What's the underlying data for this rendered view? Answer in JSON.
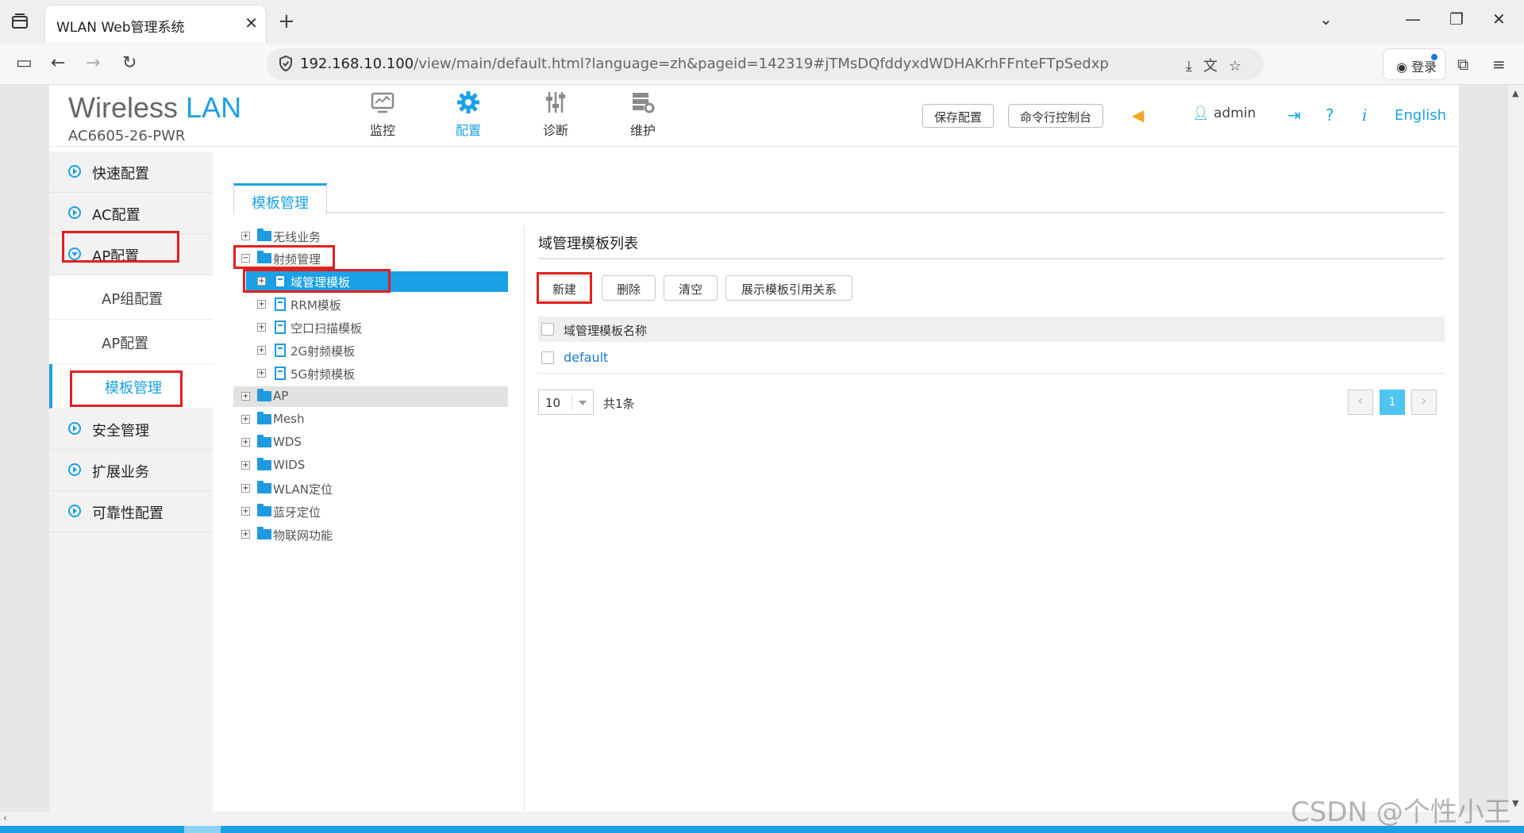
{
  "browser": {
    "tab_title": "WLAN Web管理系统",
    "url_host": "192.168.10.100",
    "url_rest": "/view/main/default.html?language=zh&pageid=142319#jTMsDQfddyxdWDHAKrhFFnteFTpSedxp",
    "login_label": "登录"
  },
  "header": {
    "brand_word1": "Wireless",
    "brand_word2": "LAN",
    "model": "AC6605-26-PWR",
    "nav": [
      {
        "label": "监控",
        "icon": "monitor-icon"
      },
      {
        "label": "配置",
        "icon": "gear-icon"
      },
      {
        "label": "诊断",
        "icon": "sliders-icon"
      },
      {
        "label": "维护",
        "icon": "maintenance-icon"
      }
    ],
    "save_config": "保存配置",
    "cli_console": "命令行控制台",
    "user": "admin",
    "language": "English"
  },
  "sidebar": {
    "items": [
      {
        "label": "快速配置"
      },
      {
        "label": "AC配置"
      },
      {
        "label": "AP配置"
      },
      {
        "label": "AP组配置"
      },
      {
        "label": "AP配置"
      },
      {
        "label": "模板管理"
      },
      {
        "label": "安全管理"
      },
      {
        "label": "扩展业务"
      },
      {
        "label": "可靠性配置"
      }
    ]
  },
  "content": {
    "tab_label": "模板管理",
    "tree": [
      {
        "label": "无线业务"
      },
      {
        "label": "射频管理"
      },
      {
        "label": "域管理模板"
      },
      {
        "label": "RRM模板"
      },
      {
        "label": "空口扫描模板"
      },
      {
        "label": "2G射频模板"
      },
      {
        "label": "5G射频模板"
      },
      {
        "label": "AP"
      },
      {
        "label": "Mesh"
      },
      {
        "label": "WDS"
      },
      {
        "label": "WIDS"
      },
      {
        "label": "WLAN定位"
      },
      {
        "label": "蓝牙定位"
      },
      {
        "label": "物联网功能"
      }
    ],
    "panel": {
      "title": "域管理模板列表",
      "buttons": {
        "create": "新建",
        "delete": "删除",
        "clear": "清空",
        "show_refs": "展示模板引用关系"
      },
      "column_header": "域管理模板名称",
      "rows": [
        {
          "name": "default"
        }
      ],
      "page_size": "10",
      "total": "共1条",
      "current_page": "1"
    }
  },
  "watermark": "CSDN @个性小王"
}
